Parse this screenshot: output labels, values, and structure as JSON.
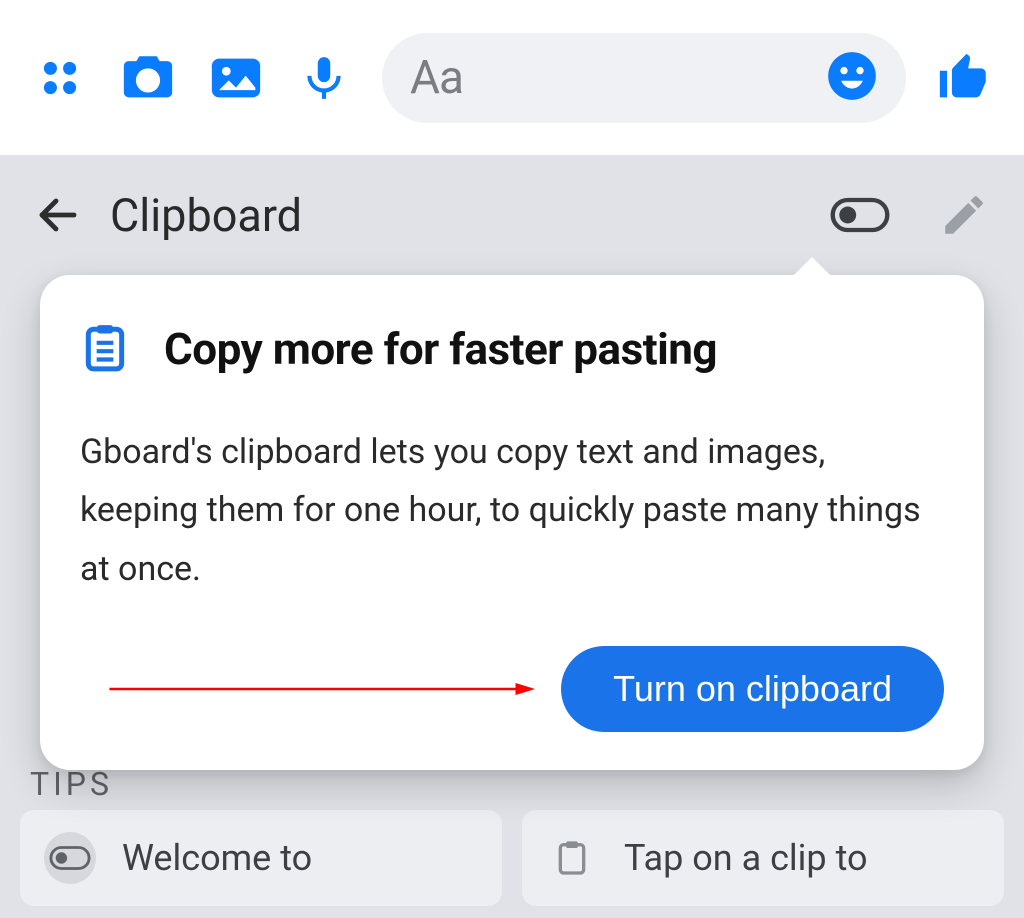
{
  "chat": {
    "placeholder": "Aa"
  },
  "clipboard": {
    "header_title": "Clipboard",
    "popover_title": "Copy more for faster pasting",
    "popover_description": "Gboard's clipboard lets you copy text and images, keeping them for one hour, to quickly paste many things at once.",
    "action_label": "Turn on clipboard",
    "tips_label": "TIPS",
    "tips": [
      {
        "text": "Welcome to"
      },
      {
        "text": "Tap on a clip to"
      }
    ]
  }
}
